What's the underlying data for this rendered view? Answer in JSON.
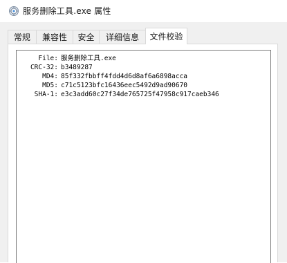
{
  "window": {
    "title": "服务删除工具.exe 属性",
    "icon": "gear-app-icon"
  },
  "tabs": [
    {
      "label": "常规",
      "active": false
    },
    {
      "label": "兼容性",
      "active": false
    },
    {
      "label": "安全",
      "active": false
    },
    {
      "label": "详细信息",
      "active": false
    },
    {
      "label": "文件校验",
      "active": true
    }
  ],
  "checksum": {
    "rows": [
      {
        "label": "File:",
        "value": "服务删除工具.exe"
      },
      {
        "label": "CRC-32:",
        "value": "b3489287"
      },
      {
        "label": "MD4:",
        "value": "85f332fbbff4fdd4d6d8af6a6898acca"
      },
      {
        "label": "MD5:",
        "value": "c71c5123bfc16436eec5492d9ad90670"
      },
      {
        "label": "SHA-1:",
        "value": "e3c3add60c27f34de765725f47958c917caeb346"
      }
    ]
  }
}
